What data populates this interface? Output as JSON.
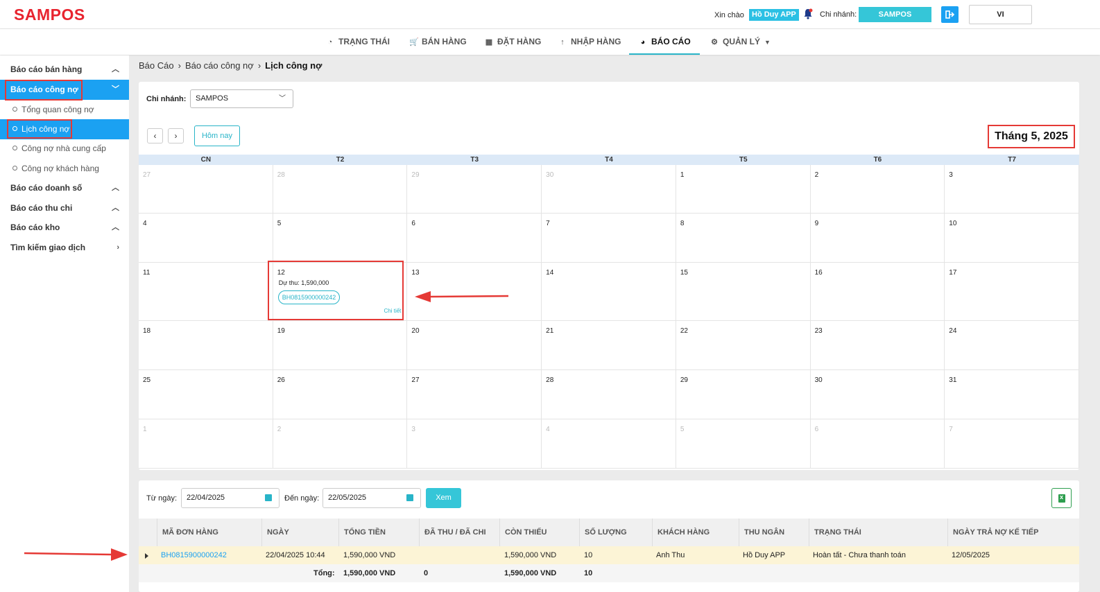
{
  "header": {
    "logo": "SAMPOS",
    "greeting": "Xin chào",
    "user": "Hồ Duy APP",
    "branch_label": "Chi nhánh:",
    "branch_value": "SAMPOS",
    "language": "VI"
  },
  "nav": [
    {
      "label": "TRẠNG THÁI",
      "icon": "gauge-icon"
    },
    {
      "label": "BÁN HÀNG",
      "icon": "cart-icon"
    },
    {
      "label": "ĐẶT HÀNG",
      "icon": "calendar-icon"
    },
    {
      "label": "NHẬP HÀNG",
      "icon": "arrow-up-icon"
    },
    {
      "label": "BÁO CÁO",
      "icon": "pie-chart-icon",
      "active": true
    },
    {
      "label": "QUẢN LÝ",
      "icon": "gear-icon"
    }
  ],
  "sidebar": {
    "items": [
      {
        "label": "Báo cáo bán hàng",
        "type": "group"
      },
      {
        "label": "Báo cáo công nợ",
        "type": "group",
        "expanded": true
      },
      {
        "label": "Tổng quan công nợ",
        "type": "sub"
      },
      {
        "label": "Lịch công nợ",
        "type": "sub",
        "active": true
      },
      {
        "label": "Công nợ nhà cung cấp",
        "type": "sub"
      },
      {
        "label": "Công nợ khách hàng",
        "type": "sub"
      },
      {
        "label": "Báo cáo doanh số",
        "type": "group"
      },
      {
        "label": "Báo cáo thu chi",
        "type": "group"
      },
      {
        "label": "Báo cáo kho",
        "type": "group"
      },
      {
        "label": "Tìm kiếm giao dịch",
        "type": "group"
      }
    ]
  },
  "breadcrumb": [
    "Báo Cáo",
    "Báo cáo công nợ",
    "Lịch công nợ"
  ],
  "calendar": {
    "branch_label": "Chi nhánh:",
    "branch_value": "SAMPOS",
    "today_label": "Hôm nay",
    "month_title": "Tháng 5, 2025",
    "weekdays": [
      "CN",
      "T2",
      "T3",
      "T4",
      "T5",
      "T6",
      "T7"
    ],
    "weeks": [
      [
        {
          "d": "27",
          "o": true
        },
        {
          "d": "28",
          "o": true
        },
        {
          "d": "29",
          "o": true
        },
        {
          "d": "30",
          "o": true
        },
        {
          "d": "1"
        },
        {
          "d": "2"
        },
        {
          "d": "3"
        }
      ],
      [
        {
          "d": "4"
        },
        {
          "d": "5"
        },
        {
          "d": "6"
        },
        {
          "d": "7"
        },
        {
          "d": "8"
        },
        {
          "d": "9"
        },
        {
          "d": "10"
        }
      ],
      [
        {
          "d": "11"
        },
        {
          "d": "12"
        },
        {
          "d": "13"
        },
        {
          "d": "14"
        },
        {
          "d": "15"
        },
        {
          "d": "16"
        },
        {
          "d": "17"
        }
      ],
      [
        {
          "d": "18"
        },
        {
          "d": "19"
        },
        {
          "d": "20"
        },
        {
          "d": "21"
        },
        {
          "d": "22"
        },
        {
          "d": "23"
        },
        {
          "d": "24"
        }
      ],
      [
        {
          "d": "25"
        },
        {
          "d": "26"
        },
        {
          "d": "27"
        },
        {
          "d": "28"
        },
        {
          "d": "29"
        },
        {
          "d": "30"
        },
        {
          "d": "31"
        }
      ],
      [
        {
          "d": "1",
          "o": true
        },
        {
          "d": "2",
          "o": true
        },
        {
          "d": "3",
          "o": true
        },
        {
          "d": "4",
          "o": true
        },
        {
          "d": "5",
          "o": true
        },
        {
          "d": "6",
          "o": true
        },
        {
          "d": "7",
          "o": true
        }
      ]
    ],
    "event": {
      "day": "12",
      "due": "Dự thu: 1,590,000",
      "code": "BH0815900000242",
      "detail": "Chi tiết"
    }
  },
  "filter": {
    "from_label": "Từ ngày:",
    "from_value": "22/04/2025",
    "to_label": "Đến ngày:",
    "to_value": "22/05/2025",
    "view_label": "Xem"
  },
  "table": {
    "columns": [
      "MÃ ĐƠN HÀNG",
      "NGÀY",
      "TỔNG TIỀN",
      "ĐÃ THU / ĐÃ CHI",
      "CÒN THIẾU",
      "SỐ LƯỢNG",
      "KHÁCH HÀNG",
      "THU NGÂN",
      "TRẠNG THÁI",
      "NGÀY TRẢ NỢ KẾ TIẾP"
    ],
    "rows": [
      [
        "BH0815900000242",
        "22/04/2025 10:44",
        "1,590,000 VND",
        "",
        "1,590,000 VND",
        "10",
        "Anh Thu",
        "Hồ Duy APP",
        "Hoàn tất - Chưa thanh toán",
        "12/05/2025"
      ]
    ],
    "total": {
      "label": "Tổng:",
      "total_amount": "1,590,000 VND",
      "paid": "0",
      "remaining": "1,590,000 VND",
      "quantity": "10"
    }
  },
  "colors": {
    "brand": "#e8242f",
    "accent": "#28b4c8",
    "primary": "#1ba1f2",
    "highlight": "#e53935",
    "row_highlight": "#fcf4d6"
  }
}
